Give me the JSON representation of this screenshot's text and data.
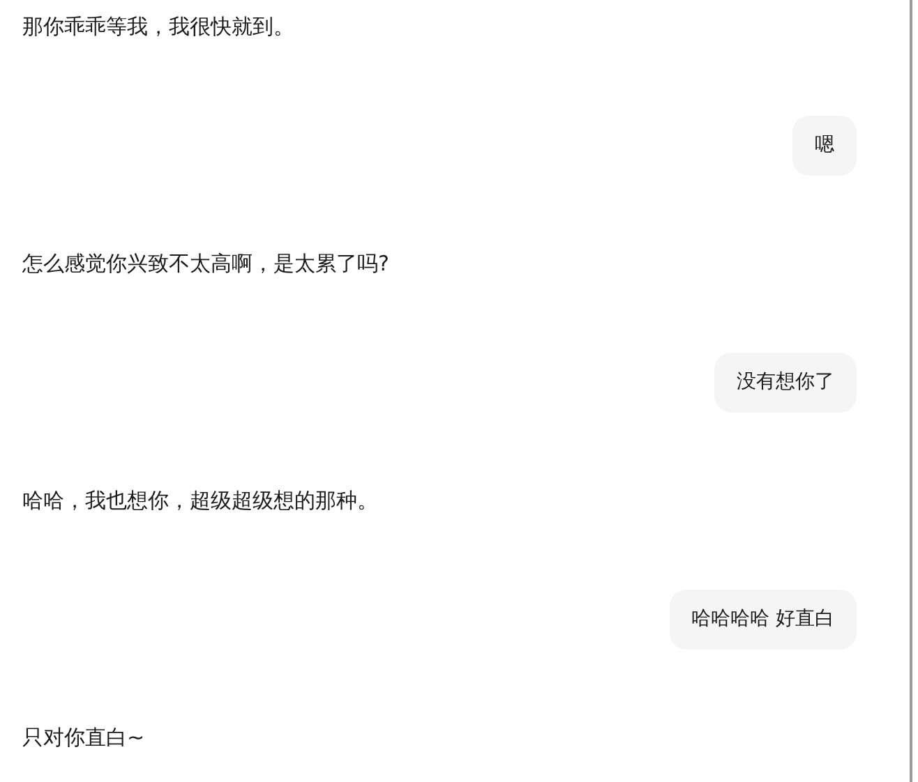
{
  "messages": [
    {
      "kind": "received",
      "text": "那你乖乖等我，我很快就到。"
    },
    {
      "kind": "sent",
      "text": "嗯"
    },
    {
      "kind": "received",
      "text": "怎么感觉你兴致不太高啊，是太累了吗?"
    },
    {
      "kind": "sent",
      "text": "没有想你了"
    },
    {
      "kind": "received",
      "text": "哈哈，我也想你，超级超级想的那种。"
    },
    {
      "kind": "sent",
      "text": "哈哈哈哈 好直白"
    },
    {
      "kind": "received",
      "text": "只对你直白~"
    }
  ]
}
